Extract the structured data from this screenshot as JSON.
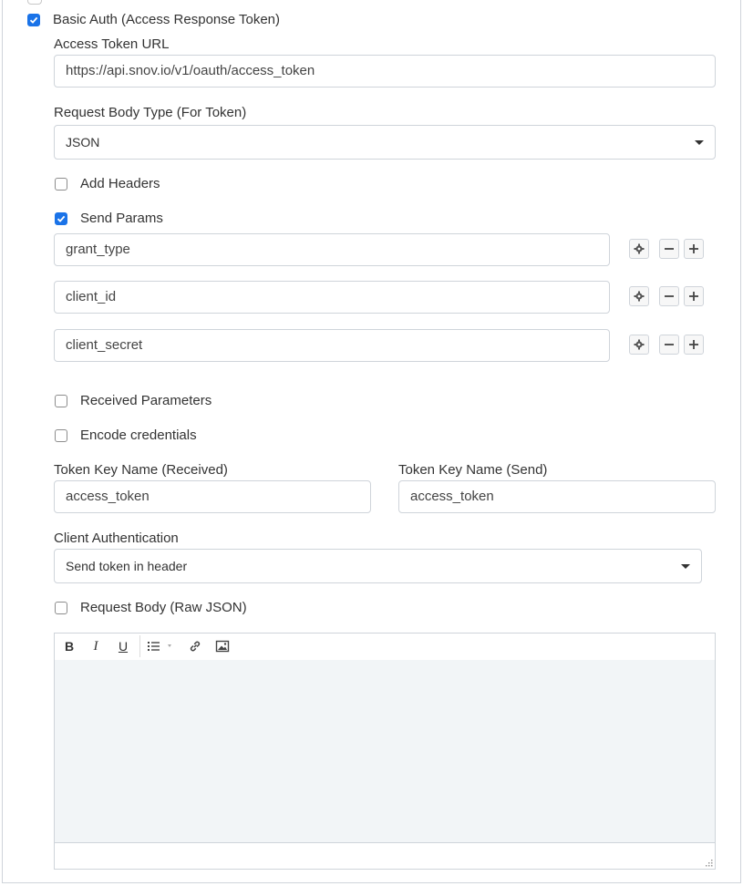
{
  "basic_auth": {
    "label": "Basic Auth (Access Response Token)",
    "checked": true
  },
  "access_token_url": {
    "label": "Access Token URL",
    "value": "https://api.snov.io/v1/oauth/access_token"
  },
  "request_body_type": {
    "label": "Request Body Type (For Token)",
    "selected": "JSON"
  },
  "add_headers": {
    "label": "Add Headers",
    "checked": false
  },
  "send_params": {
    "label": "Send Params",
    "checked": true,
    "params": [
      {
        "value": "grant_type"
      },
      {
        "value": "client_id"
      },
      {
        "value": "client_secret"
      }
    ]
  },
  "received_parameters": {
    "label": "Received Parameters",
    "checked": false
  },
  "encode_credentials": {
    "label": "Encode credentials",
    "checked": false
  },
  "token_key_received": {
    "label": "Token Key Name (Received)",
    "value": "access_token"
  },
  "token_key_send": {
    "label": "Token Key Name (Send)",
    "value": "access_token"
  },
  "client_authentication": {
    "label": "Client Authentication",
    "selected": "Send token in header"
  },
  "request_body_raw": {
    "label": "Request Body (Raw JSON)",
    "checked": false
  },
  "editor_toolbar": {
    "icons": [
      "bold-icon",
      "italic-icon",
      "underline-icon",
      "list-icon",
      "link-icon",
      "image-icon"
    ],
    "bold_glyph": "B",
    "italic_glyph": "I",
    "underline_glyph": "U"
  },
  "colors": {
    "accent": "#1a73e8",
    "border": "#cfd4da",
    "editor_bg": "#f2f5f7"
  }
}
